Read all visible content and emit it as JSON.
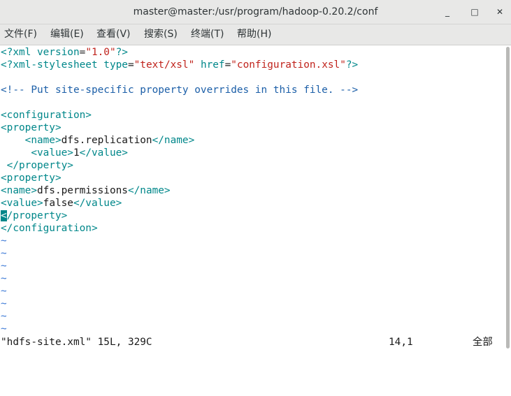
{
  "window": {
    "title": "master@master:/usr/program/hadoop-0.20.2/conf",
    "minimize_glyph": "_",
    "maximize_glyph": "□",
    "close_glyph": "✕"
  },
  "menu": [
    "文件(F)",
    "编辑(E)",
    "查看(V)",
    "搜索(S)",
    "终端(T)",
    "帮助(H)"
  ],
  "editor": {
    "l1": [
      "<?xml ",
      "version",
      "=",
      "\"1.0\"",
      "?>"
    ],
    "l2": [
      "<?xml-stylesheet ",
      "type",
      "=",
      "\"text/xsl\"",
      " ",
      "href",
      "=",
      "\"configuration.xsl\"",
      "?>"
    ],
    "l4": "<!-- Put site-specific property overrides in this file. -->",
    "l6": "<configuration>",
    "l7": "<property>",
    "l8": [
      "    ",
      "<name>",
      "dfs.replication",
      "</name>"
    ],
    "l9": [
      "     ",
      "<value>",
      "1",
      "</value>"
    ],
    "l10": " </property>",
    "l11": "<property>",
    "l12": [
      "<name>",
      "dfs.permissions",
      "</name>"
    ],
    "l13": [
      "<value>",
      "false",
      "</value>"
    ],
    "l14": [
      "<",
      "/property>"
    ],
    "l15": "</configuration>",
    "tilde": "~"
  },
  "status": {
    "file_info": "\"hdfs-site.xml\" 15L, 329C",
    "position": "14,1",
    "scroll": "全部"
  }
}
